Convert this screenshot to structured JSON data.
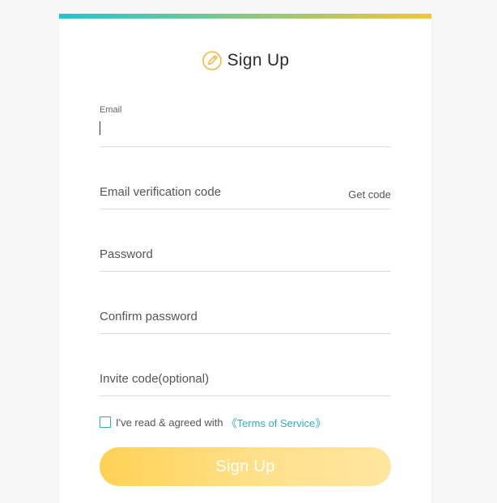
{
  "header": {
    "title": "Sign Up"
  },
  "form": {
    "email": {
      "label": "Email",
      "value": ""
    },
    "email_code": {
      "placeholder": "Email verification code",
      "get_code_label": "Get code"
    },
    "password": {
      "placeholder": "Password"
    },
    "confirm_password": {
      "placeholder": "Confirm password"
    },
    "invite_code": {
      "placeholder": "Invite code(optional)"
    },
    "agreement": {
      "text": "I've read & agreed with",
      "link_text": "《Terms of Service》",
      "checked": false
    },
    "submit_label": "Sign Up"
  },
  "colors": {
    "accent_teal": "#2ab3c0",
    "accent_yellow": "#ffd255",
    "topbar_start": "#1fc6d0",
    "topbar_end": "#f3c63a"
  },
  "icons": {
    "title_icon": "pencil-circle-icon"
  }
}
